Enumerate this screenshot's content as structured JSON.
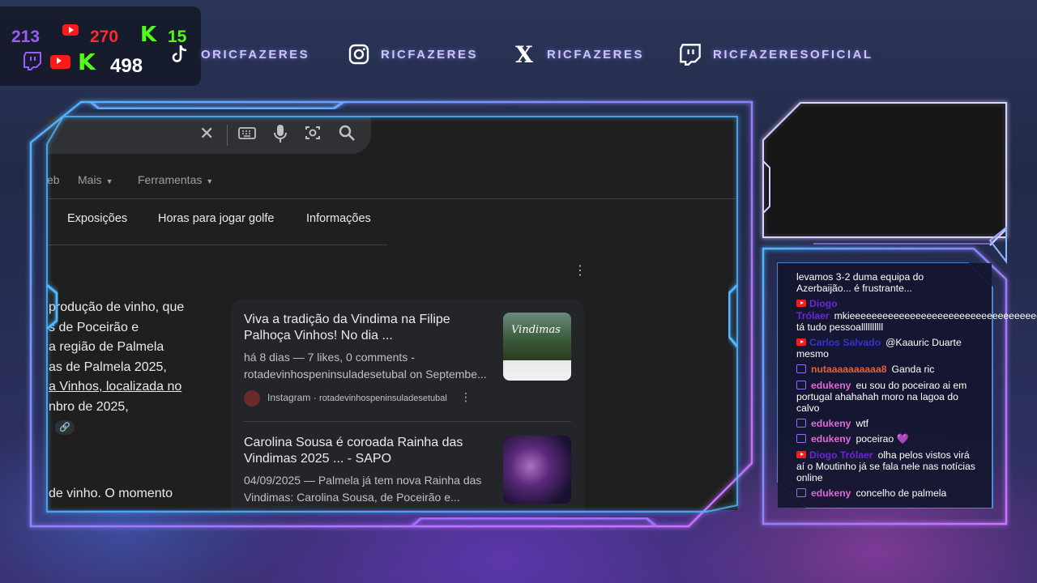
{
  "stats": {
    "twitch_count": "213",
    "youtube_count": "270",
    "kick_logo": "K",
    "kick_count": "15",
    "total_count": "498"
  },
  "social": {
    "tiktok": "ORICFAZERES",
    "instagram": "RICFAZERES",
    "x": "RICFAZERES",
    "twitch": "RICFAZERESOFICIAL",
    "x_glyph": "X"
  },
  "browser": {
    "tab_partial": "eb",
    "tab_more": "Mais",
    "tab_tools": "Ferramentas",
    "chips": [
      "Exposições",
      "Horas para jogar golfe",
      "Informações"
    ],
    "left_lines": [
      "produção de vinho, que",
      "s de Poceirão e",
      "a região de Palmela",
      "as de Palmela 2025,",
      "a Vinhos, localizada no",
      "nbro de 2025,",
      "de vinho. O momento"
    ],
    "results": [
      {
        "title_1": "Viva a tradição da Vindima na Filipe",
        "title_2": "Palhoça Vinhos! No dia ...",
        "meta_1": "há 8 dias — 7 likes, 0 comments -",
        "meta_2": "rotadevinhospeninsuladesetubal on Septembe...",
        "source": "Instagram",
        "source_account": "rotadevinhospeninsuladesetubal",
        "thumb_text": "Vindimas"
      },
      {
        "title_1": "Carolina Sousa é coroada Rainha das",
        "title_2": "Vindimas 2025 ... - SAPO",
        "meta_1": "04/09/2025 — Palmela já tem nova Rainha das",
        "meta_2": "Vindimas: Carolina Sousa, de Poceirão e..."
      }
    ]
  },
  "chat": {
    "messages": [
      {
        "platform": "",
        "name": "",
        "name_color": "#ffffff",
        "text": "levamos 3-2 duma equipa do Azerbaijão... é frustrante..."
      },
      {
        "platform": "youtube",
        "name": "Diogo Trólaer",
        "name_color": "#6a28d6",
        "text": "mkieeeeeeeeeeeeeeeeeeeeeeeeeeeeeeeeeeee tá tudo pessoallllllllll"
      },
      {
        "platform": "youtube",
        "name": "Carlos Salvado",
        "name_color": "#3b2fd0",
        "text": "@Kaauric Duarte mesmo"
      },
      {
        "platform": "twitch",
        "name": "nutaaaaaaaaaa8",
        "name_color": "#e0623a",
        "text": "Ganda ric"
      },
      {
        "platform": "twitch",
        "name": "edukeny",
        "name_color": "#e06ad6",
        "text": "eu sou do poceirao ai em portugal ahahahah moro na lagoa do calvo"
      },
      {
        "platform": "twitch",
        "name": "edukeny",
        "name_color": "#e06ad6",
        "text": "wtf"
      },
      {
        "platform": "twitch",
        "name": "edukeny",
        "name_color": "#e06ad6",
        "text": "poceirao 💜"
      },
      {
        "platform": "youtube",
        "name": "Diogo Trólaer",
        "name_color": "#6a28d6",
        "text": "olha pelos vistos virá aí o Moutinho já se fala nele nas notícias online"
      },
      {
        "platform": "twitch",
        "name": "edukeny",
        "name_color": "#e06ad6",
        "text": "concelho de palmela"
      }
    ]
  },
  "colors": {
    "frame_blue": "#4fb6ff",
    "frame_purple": "#b35cff",
    "twitch": "#9146ff",
    "kick": "#53fc18",
    "youtube": "#ff1a1a"
  }
}
